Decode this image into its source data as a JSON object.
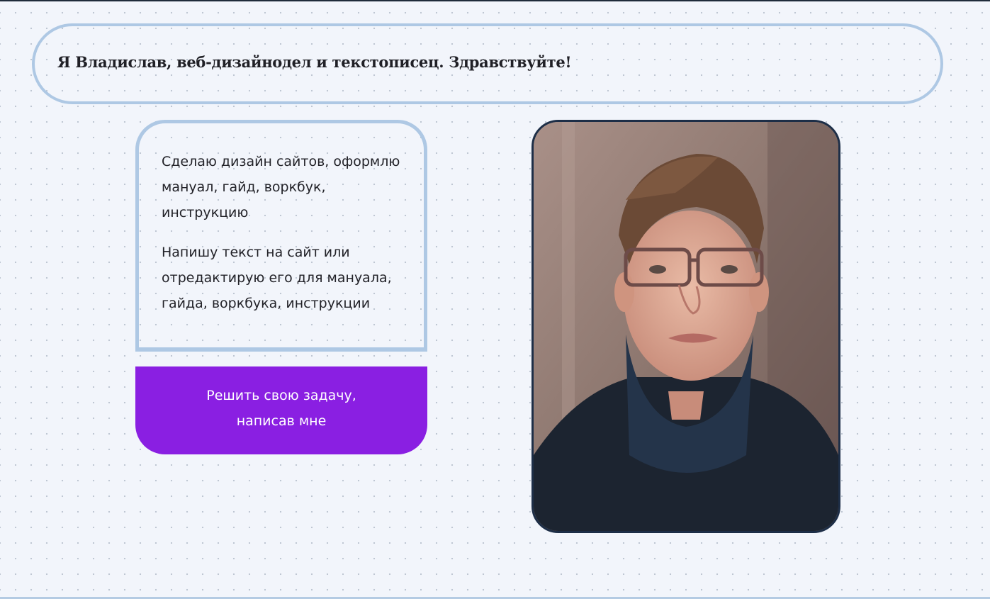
{
  "intro": {
    "text": "Я Владислав, веб-дизайнодел и текстописец. Здравствуйте!"
  },
  "services": {
    "items": [
      "Сделаю дизайн сайтов, оформлю мануал, гайд, воркбук, инструкцию",
      "Напишу текст на сайт или отредактирую его для мануала, гайда, воркбука, инструкции"
    ]
  },
  "cta": {
    "label": "Решить свою задачу,\nнаписав мне",
    "color": "#8a1fe2"
  },
  "photo": {
    "subject": "portrait-photo"
  },
  "colors": {
    "background": "#f2f5fb",
    "border": "#aec8e4",
    "accent": "#8a1fe2",
    "photo_frame": "#1d2e47"
  }
}
